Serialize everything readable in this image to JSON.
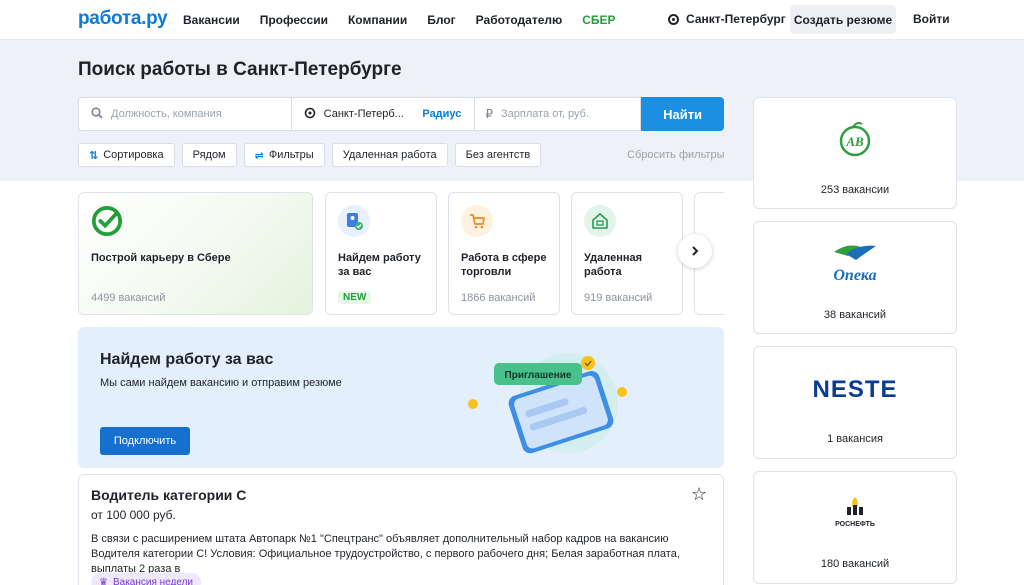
{
  "header": {
    "logo": "работа.ру",
    "nav": [
      "Вакансии",
      "Профессии",
      "Компании",
      "Блог",
      "Работодателю",
      "СБЕР"
    ],
    "city": "Санкт-Петербург",
    "create_resume": "Создать резюме",
    "login": "Войти"
  },
  "search": {
    "title": "Поиск работы в Санкт-Петербурге",
    "job_placeholder": "Должность, компания",
    "city_value": "Санкт-Петерб...",
    "radius_label": "Радиус",
    "salary_placeholder": "Зарплата от, руб.",
    "find_button": "Найти",
    "filters": [
      "Сортировка",
      "Рядом",
      "Фильтры",
      "Удаленная работа",
      "Без агентств"
    ],
    "reset_filters": "Сбросить фильтры"
  },
  "categories": [
    {
      "title": "Построй карьеру в Сбере",
      "count": "4499 вакансий"
    },
    {
      "title": "Найдем работу за вас",
      "badge": "NEW"
    },
    {
      "title": "Работа в сфере торговли",
      "count": "1866 вакансий"
    },
    {
      "title": "Удаленная работа",
      "count": "919 вакансий"
    }
  ],
  "promo": {
    "title": "Найдем работу за вас",
    "subtitle": "Мы сами найдем вакансию и отправим резюме",
    "button": "Подключить",
    "invite_label": "Приглашение"
  },
  "vacancy": {
    "title": "Водитель категории С",
    "salary": "от 100 000 руб.",
    "description": "В связи с расширением штата Автопарк №1 \"Спецтранс\" объявляет дополнительный набор кадров на вакансию Водителя категории С! Условия: Официальное трудоустройство, с первого рабочего дня; Белая заработная плата, выплаты 2 раза в",
    "badge": "Вакансия недели"
  },
  "employers": [
    {
      "logo_text": "АВ",
      "count": "253 вакансии",
      "color": "#2e9e3e"
    },
    {
      "logo_text": "Опека",
      "count": "38 вакансий",
      "color": "#1b6fb8"
    },
    {
      "logo_text": "NESTE",
      "count": "1 вакансия",
      "color": "#0a3d91"
    },
    {
      "logo_text": "РОСНЕФТЬ",
      "count": "180 вакансий",
      "color": "#1f2329"
    }
  ],
  "colors": {
    "brand": "#0b7bd6",
    "accent_button": "#1a8fe3",
    "sber_green": "#21a038",
    "hero_bg": "#eef2f8"
  }
}
